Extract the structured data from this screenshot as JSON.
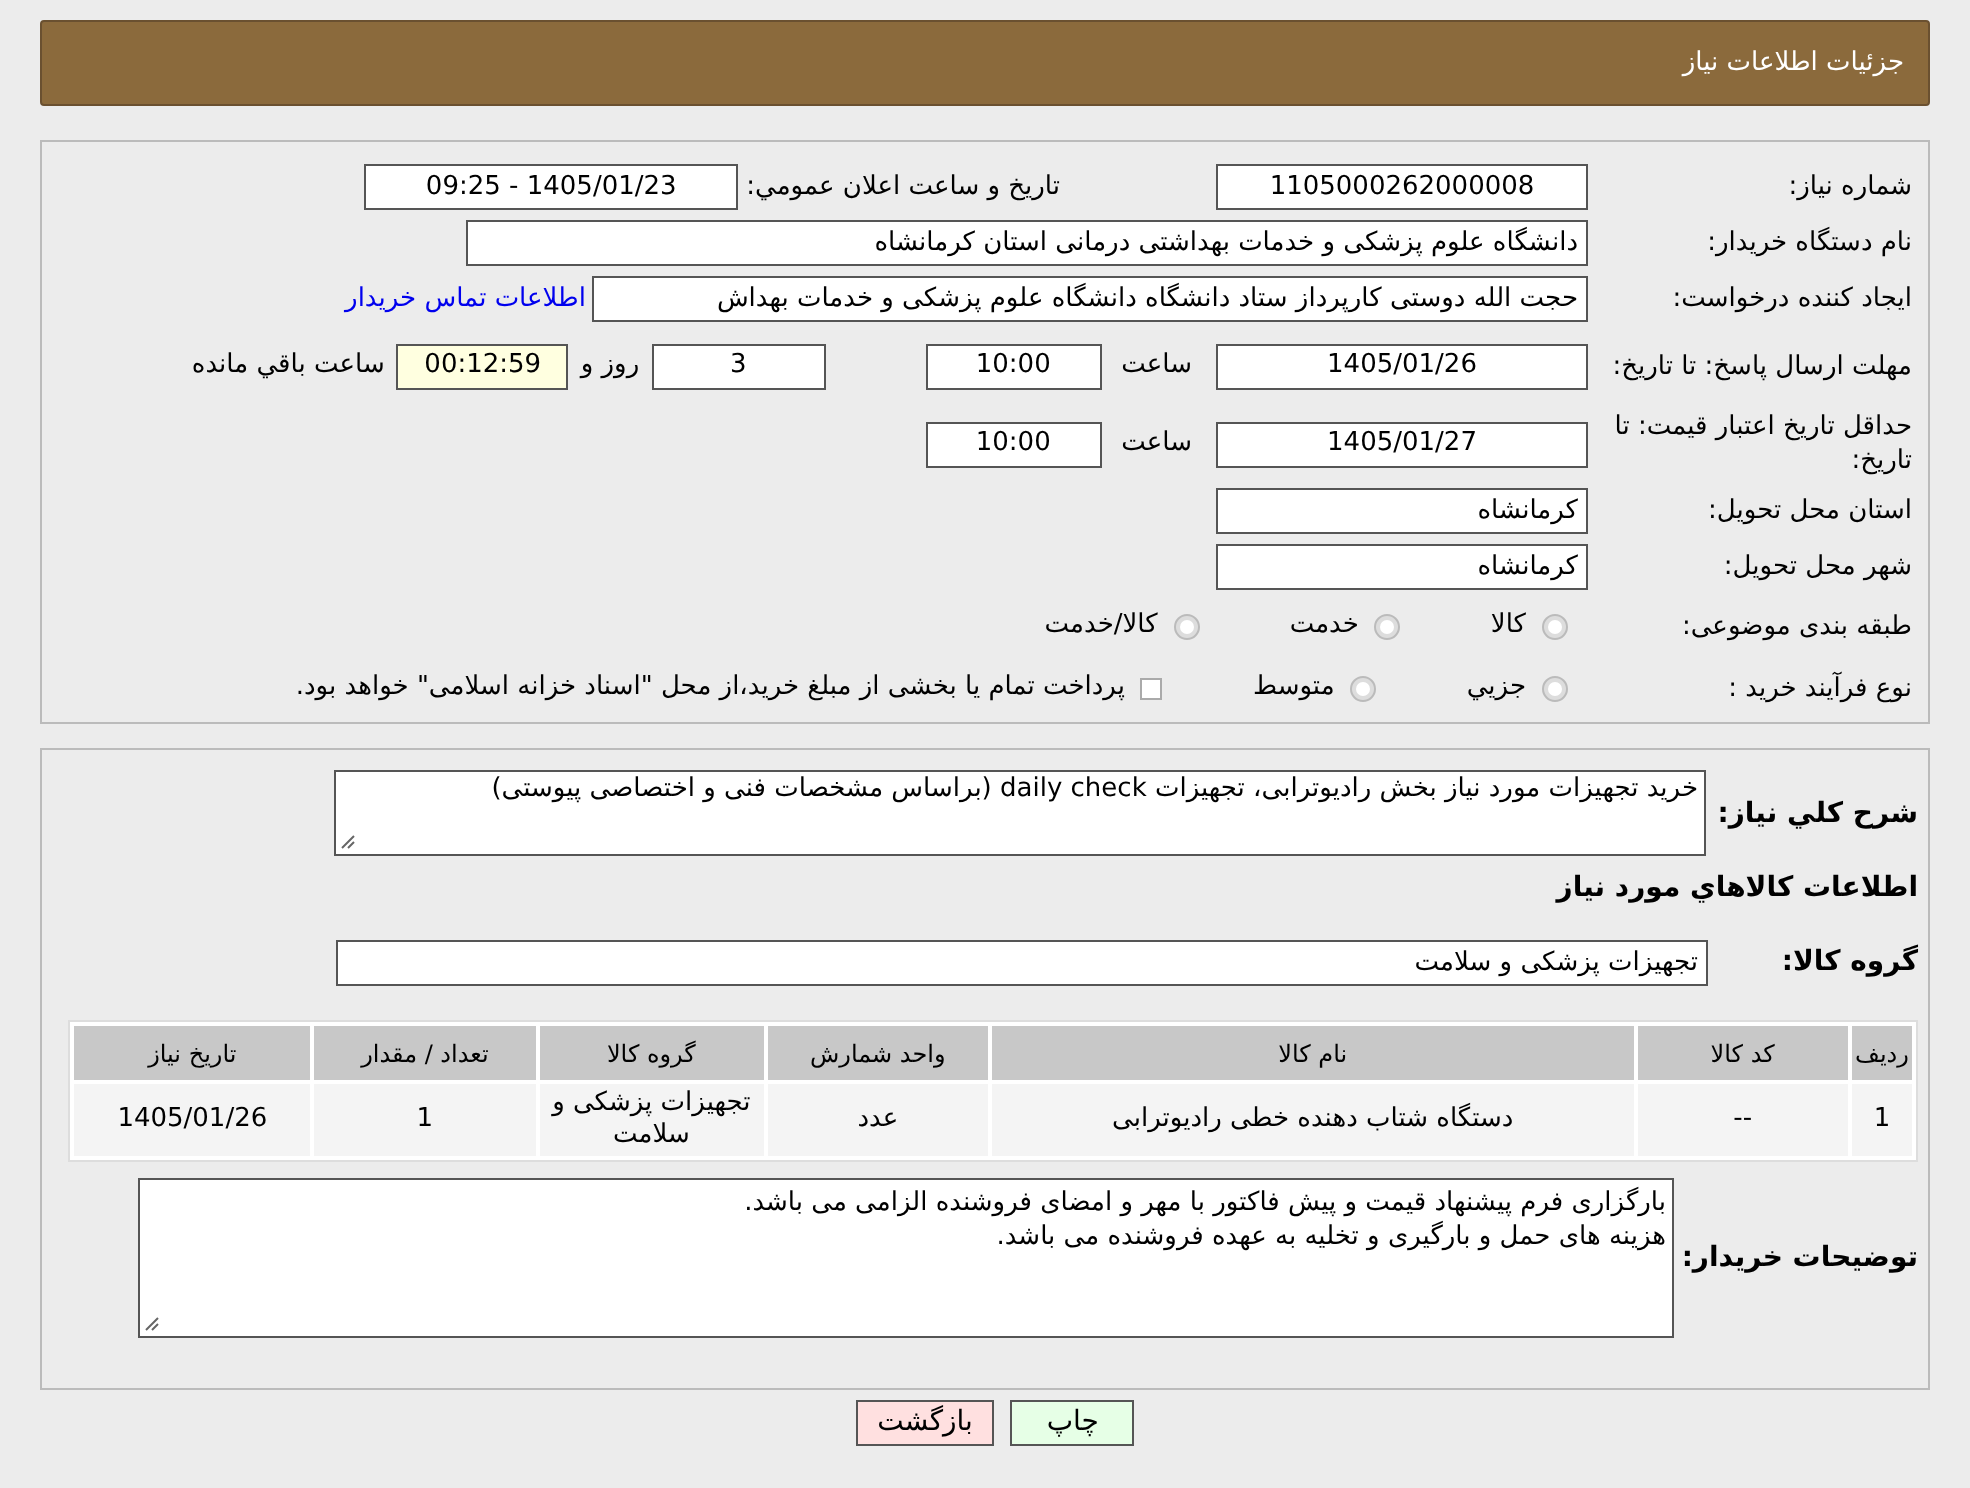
{
  "header": {
    "title": "جزئیات اطلاعات نیاز"
  },
  "need_number": {
    "label": "شماره نیاز:",
    "value": "1105000262000008"
  },
  "announce": {
    "label": "تاریخ و ساعت اعلان عمومي:",
    "value": "1405/01/23 - 09:25"
  },
  "buyer": {
    "label": "نام دستگاه خریدار:",
    "value": "دانشگاه علوم پزشکی و خدمات بهداشتی  درمانی استان کرمانشاه"
  },
  "requester": {
    "label": "ایجاد کننده درخواست:",
    "value": "حجت الله دوستی  کارپرداز ستاد دانشگاه دانشگاه علوم پزشکی و خدمات بهداش",
    "link": "اطلاعات تماس خریدار"
  },
  "reply_deadline": {
    "label": "مهلت ارسال پاسخ: تا تاریخ:",
    "date": "1405/01/26",
    "time_label": "ساعت",
    "time": "10:00",
    "days": "3",
    "days_label": "روز و",
    "remaining": "00:12:59",
    "remaining_label": "ساعت باقي مانده"
  },
  "price_validity": {
    "label": "حداقل تاریخ اعتبار قیمت: تا تاریخ:",
    "date": "1405/01/27",
    "time_label": "ساعت",
    "time": "10:00"
  },
  "province": {
    "label": "استان محل تحویل:",
    "value": "کرمانشاه"
  },
  "city": {
    "label": "شهر محل تحویل:",
    "value": "کرمانشاه"
  },
  "category": {
    "label": "طبقه بندی موضوعی:",
    "options": [
      {
        "label": "کالا",
        "selected": false
      },
      {
        "label": "خدمت",
        "selected": false
      },
      {
        "label": "کالا/خدمت",
        "selected": false
      }
    ]
  },
  "purchase_type": {
    "label": "نوع فرآیند خرید :",
    "options": [
      {
        "kind": "radio",
        "label": "جزيي",
        "selected": false
      },
      {
        "kind": "radio",
        "label": "متوسط",
        "selected": false
      },
      {
        "kind": "checkbox",
        "label": "پرداخت تمام یا بخشی از مبلغ خرید،از محل \"اسناد خزانه اسلامی\" خواهد بود.",
        "checked": false
      }
    ]
  },
  "description": {
    "label": "شرح کلي نیاز:",
    "value": "خرید تجهیزات مورد نیاز بخش رادیوترابی، تجهیزات daily check (براساس مشخصات فنی و اختصاصی پیوستی)"
  },
  "items_heading": "اطلاعات کالاهاي مورد نیاز",
  "group": {
    "label": "گروه کالا:",
    "value": "تجهیزات پزشکی و سلامت"
  },
  "table": {
    "columns": [
      "رديف",
      "کد کالا",
      "نام کالا",
      "واحد شمارش",
      "گروه کالا",
      "تعداد / مقدار",
      "تاریخ نیاز"
    ],
    "rows": [
      [
        "1",
        "--",
        "دستگاه شتاب دهنده خطی رادیوترابی",
        "عدد",
        "تجهیزات پزشکی و سلامت",
        "1",
        "1405/01/26"
      ]
    ]
  },
  "notes": {
    "label": "توضیحات خریدار:",
    "lines": [
      "بارگزاری فرم پیشنهاد قیمت و پیش فاکتور با مهر و امضای فروشنده الزامی می باشد.",
      "هزینه های حمل و بارگیری و تخلیه به عهده فروشنده می باشد."
    ]
  },
  "buttons": [
    {
      "kind": "print",
      "label": "چاپ"
    },
    {
      "kind": "back",
      "label": "بازگشت"
    }
  ]
}
